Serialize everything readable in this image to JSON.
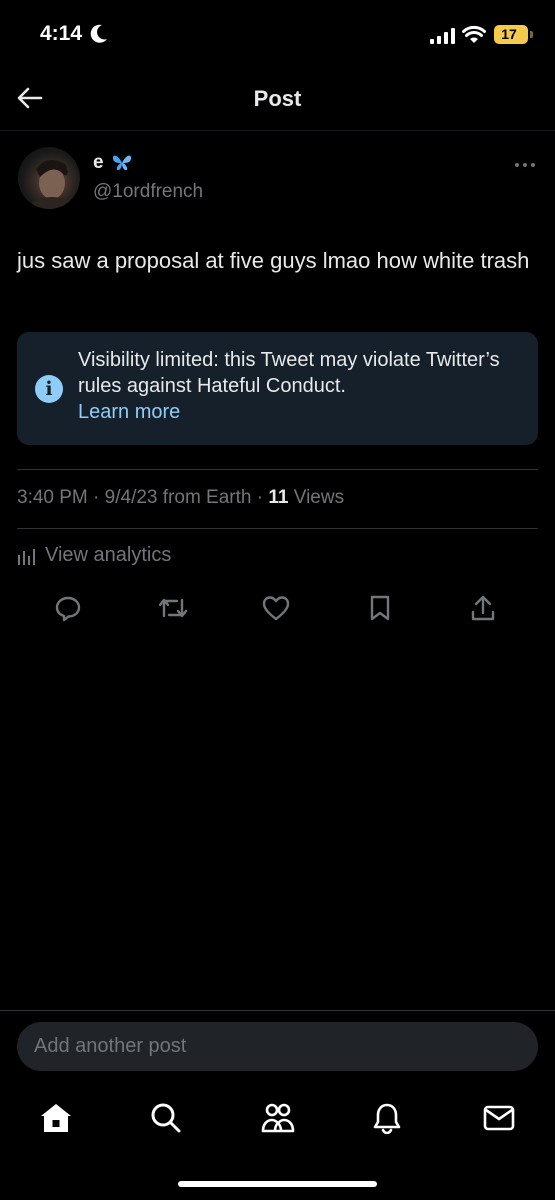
{
  "status_bar": {
    "time": "4:14",
    "battery": "17"
  },
  "header": {
    "title": "Post"
  },
  "author": {
    "display_name": "e",
    "handle": "@1ordfrench"
  },
  "tweet": {
    "text": "jus saw a proposal at five guys lmao how white trash"
  },
  "notice": {
    "text": "Visibility limited: this Tweet may violate Twitter’s rules against Hateful Conduct.",
    "link": "Learn more"
  },
  "meta": {
    "time": "3:40 PM",
    "date": "9/4/23",
    "source": "from Earth",
    "views_count": "11",
    "views_label": "Views"
  },
  "analytics": {
    "label": "View analytics"
  },
  "compose": {
    "placeholder": "Add another post"
  },
  "colors": {
    "accent": "#8ecdf8",
    "background": "#000000",
    "muted": "#71767b",
    "notice_bg": "#16202a"
  }
}
